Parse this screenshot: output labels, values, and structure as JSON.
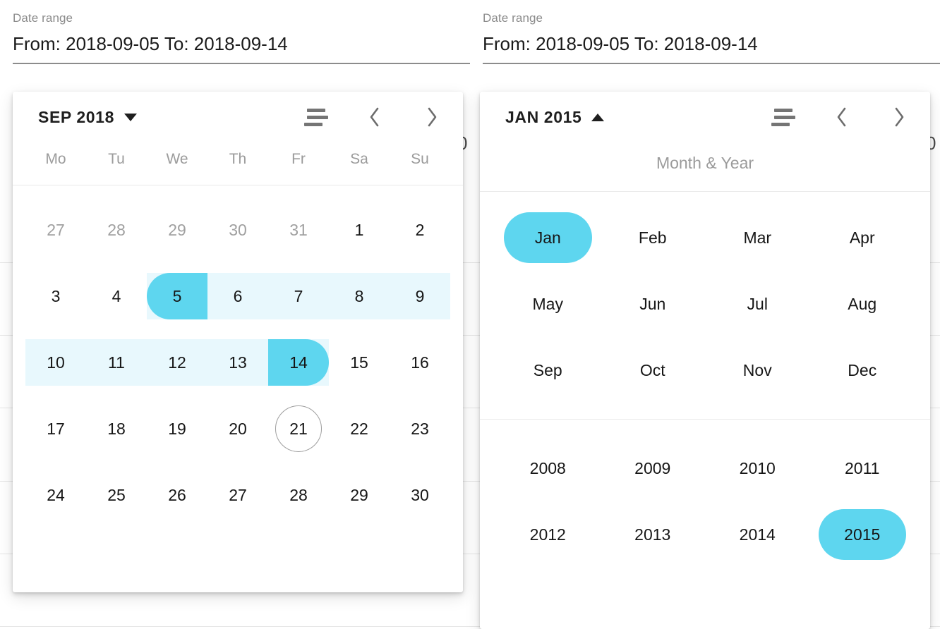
{
  "panels": [
    {
      "id": "left",
      "field": {
        "label": "Date range",
        "value": "From: 2018-09-05 To: 2018-09-14"
      },
      "calendar": {
        "title": "SEP 2018",
        "toggle_icon": "caret-down-icon",
        "actions": [
          {
            "name": "sort-icon",
            "label": "Sort"
          },
          {
            "name": "chevron-left-icon",
            "label": "Previous"
          },
          {
            "name": "chevron-right-icon",
            "label": "Next"
          }
        ],
        "weekdays": [
          "Mo",
          "Tu",
          "We",
          "Th",
          "Fr",
          "Sa",
          "Su"
        ],
        "weeks": [
          [
            {
              "day": "27",
              "state": "muted"
            },
            {
              "day": "28",
              "state": "muted"
            },
            {
              "day": "29",
              "state": "muted"
            },
            {
              "day": "30",
              "state": "muted"
            },
            {
              "day": "31",
              "state": "muted"
            },
            {
              "day": "1",
              "state": "normal"
            },
            {
              "day": "2",
              "state": "normal"
            }
          ],
          [
            {
              "day": "3",
              "state": "normal"
            },
            {
              "day": "4",
              "state": "normal"
            },
            {
              "day": "5",
              "state": "range-start"
            },
            {
              "day": "6",
              "state": "in-range"
            },
            {
              "day": "7",
              "state": "in-range"
            },
            {
              "day": "8",
              "state": "in-range"
            },
            {
              "day": "9",
              "state": "in-range"
            }
          ],
          [
            {
              "day": "10",
              "state": "in-range"
            },
            {
              "day": "11",
              "state": "in-range"
            },
            {
              "day": "12",
              "state": "in-range"
            },
            {
              "day": "13",
              "state": "in-range"
            },
            {
              "day": "14",
              "state": "range-end"
            },
            {
              "day": "15",
              "state": "normal"
            },
            {
              "day": "16",
              "state": "normal"
            }
          ],
          [
            {
              "day": "17",
              "state": "normal"
            },
            {
              "day": "18",
              "state": "normal"
            },
            {
              "day": "19",
              "state": "normal"
            },
            {
              "day": "20",
              "state": "normal"
            },
            {
              "day": "21",
              "state": "today"
            },
            {
              "day": "22",
              "state": "normal"
            },
            {
              "day": "23",
              "state": "normal"
            }
          ],
          [
            {
              "day": "24",
              "state": "normal"
            },
            {
              "day": "25",
              "state": "normal"
            },
            {
              "day": "26",
              "state": "normal"
            },
            {
              "day": "27",
              "state": "normal"
            },
            {
              "day": "28",
              "state": "normal"
            },
            {
              "day": "29",
              "state": "normal"
            },
            {
              "day": "30",
              "state": "normal"
            }
          ]
        ]
      }
    },
    {
      "id": "right",
      "field": {
        "label": "Date range",
        "value": "From: 2018-09-05 To: 2018-09-14"
      },
      "calendar": {
        "title": "JAN 2015",
        "toggle_icon": "caret-up-icon",
        "actions": [
          {
            "name": "sort-icon",
            "label": "Sort"
          },
          {
            "name": "chevron-left-icon",
            "label": "Previous"
          },
          {
            "name": "chevron-right-icon",
            "label": "Next"
          }
        ],
        "picker_label": "Month & Year",
        "months": [
          {
            "label": "Jan",
            "selected": true
          },
          {
            "label": "Feb",
            "selected": false
          },
          {
            "label": "Mar",
            "selected": false
          },
          {
            "label": "Apr",
            "selected": false
          },
          {
            "label": "May",
            "selected": false
          },
          {
            "label": "Jun",
            "selected": false
          },
          {
            "label": "Jul",
            "selected": false
          },
          {
            "label": "Aug",
            "selected": false
          },
          {
            "label": "Sep",
            "selected": false
          },
          {
            "label": "Oct",
            "selected": false
          },
          {
            "label": "Nov",
            "selected": false
          },
          {
            "label": "Dec",
            "selected": false
          }
        ],
        "years": [
          {
            "label": "2008",
            "selected": false
          },
          {
            "label": "2009",
            "selected": false
          },
          {
            "label": "2010",
            "selected": false
          },
          {
            "label": "2011",
            "selected": false
          },
          {
            "label": "2012",
            "selected": false
          },
          {
            "label": "2013",
            "selected": false
          },
          {
            "label": "2014",
            "selected": false
          },
          {
            "label": "2015",
            "selected": true
          }
        ]
      }
    }
  ],
  "colors": {
    "accent": "#5ED6EF",
    "range_fill": "#E8F8FD",
    "muted_text": "#A0A0A0",
    "label_text": "#8B8B8B",
    "value_text": "#1A1A1A",
    "divider": "#E6E6E6"
  },
  "background": {
    "row_line_offsets": [
      254,
      357,
      460,
      564,
      667,
      770
    ]
  }
}
